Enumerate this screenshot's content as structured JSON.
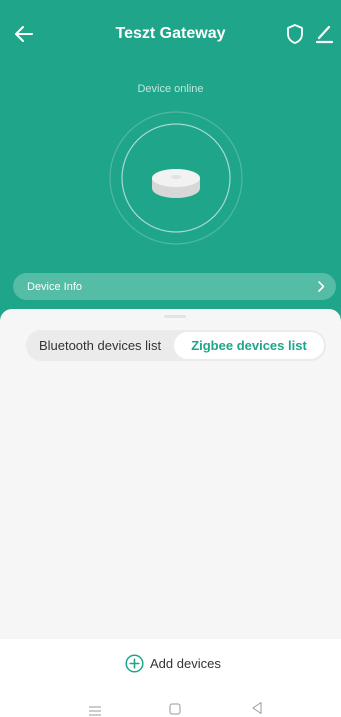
{
  "header": {
    "title": "Teszt Gateway",
    "back_icon": "arrow-left-icon",
    "shield_icon": "shield-icon",
    "edit_icon": "pencil-icon"
  },
  "device": {
    "status": "Device online",
    "image": "gateway-puck-icon"
  },
  "info_bar": {
    "label": "Device Info",
    "chevron": "chevron-right-icon"
  },
  "tabs": [
    {
      "label": "Bluetooth devices list",
      "selected": false
    },
    {
      "label": "Zigbee devices list",
      "selected": true
    }
  ],
  "footer": {
    "add_label": "Add devices",
    "add_icon": "plus-circle-icon"
  },
  "nav_bar": {
    "menu_icon": "menu-icon",
    "home_icon": "home-square-icon",
    "back_icon": "triangle-back-icon"
  },
  "colors": {
    "brand": "#1fa58a",
    "info_bar": "#55bca6",
    "sheet_background": "#f6f6f6",
    "segment_track": "#ebebeb",
    "text_dark": "#333333"
  }
}
